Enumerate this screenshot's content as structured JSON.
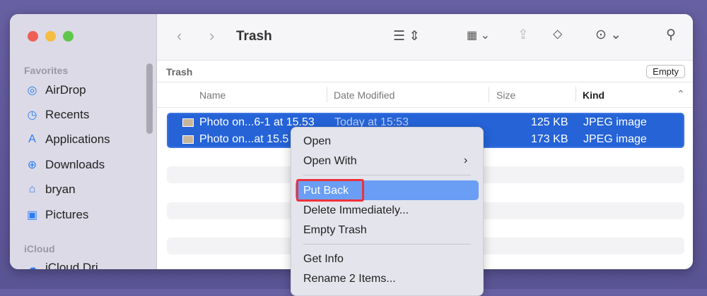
{
  "window": {
    "title": "Trash"
  },
  "sidebar": {
    "sections": [
      {
        "label": "Favorites"
      },
      {
        "label": "iCloud"
      }
    ],
    "items": [
      {
        "label": "AirDrop",
        "icon": "airdrop-icon"
      },
      {
        "label": "Recents",
        "icon": "clock-icon"
      },
      {
        "label": "Applications",
        "icon": "applications-icon"
      },
      {
        "label": "Downloads",
        "icon": "download-icon"
      },
      {
        "label": "bryan",
        "icon": "home-icon"
      },
      {
        "label": "Pictures",
        "icon": "pictures-icon"
      },
      {
        "label": "iCloud Dri",
        "icon": "cloud-icon"
      }
    ]
  },
  "path": {
    "label": "Trash",
    "empty_button": "Empty"
  },
  "columns": {
    "name": "Name",
    "date": "Date Modified",
    "size": "Size",
    "kind": "Kind"
  },
  "files": [
    {
      "name": "Photo on...6-1 at 15.53",
      "date": "Today at 15:53",
      "size": "125 KB",
      "kind": "JPEG image"
    },
    {
      "name": "Photo on...at 15.5",
      "date": "",
      "size": "173 KB",
      "kind": "JPEG image"
    }
  ],
  "menu": {
    "items": [
      "Open",
      "Open With",
      "Put Back",
      "Delete Immediately...",
      "Empty Trash",
      "Get Info",
      "Rename 2 Items..."
    ],
    "highlighted": "Put Back"
  },
  "colors": {
    "selection": "#2563d7",
    "highlight": "#6a9ef5",
    "annotation": "#f0313b"
  }
}
